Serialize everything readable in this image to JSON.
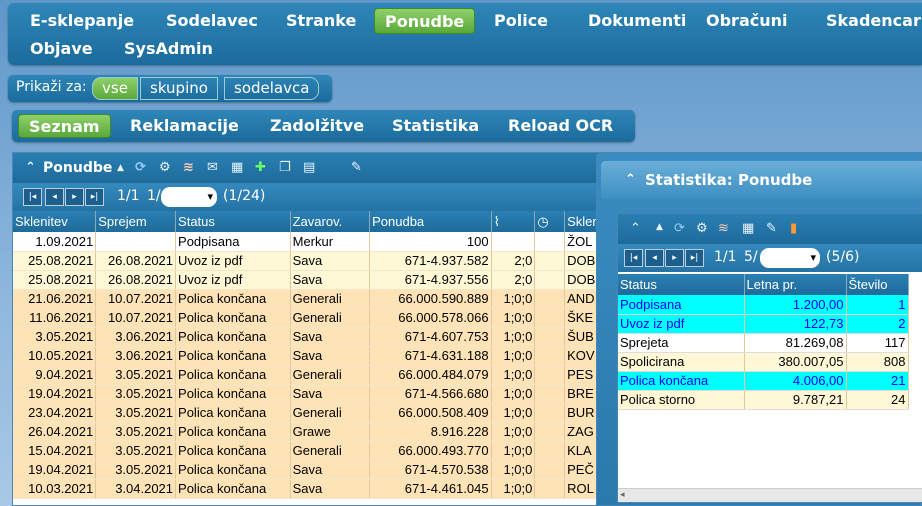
{
  "topnav": {
    "row1": [
      "E-sklepanje",
      "Sodelavec",
      "Stranke",
      "Ponudbe",
      "Police",
      "Dokumenti",
      "Obračuni",
      "Skadencar"
    ],
    "row2": [
      "Objave",
      "SysAdmin"
    ],
    "active": "Ponudbe"
  },
  "filter": {
    "label": "Prikaži za:",
    "options": [
      "vse",
      "skupino",
      "sodelavca"
    ],
    "active": "vse"
  },
  "subnav": {
    "items": [
      "Seznam",
      "Reklamacije",
      "Zadolžitve",
      "Statistika",
      "Reload OCR"
    ],
    "active": "Seznam"
  },
  "main": {
    "title": "Ponudbe",
    "page": "1/1",
    "page2": "1/",
    "count": "(1/24)",
    "columns": [
      "Sklenitev",
      "Sprejem",
      "Status",
      "Zavarov.",
      "Ponudba",
      "",
      "",
      "Sklen"
    ],
    "rows": [
      [
        "1.09.2021",
        "",
        "Podpisana",
        "Merkur",
        "100",
        "",
        "",
        "ŽOL"
      ],
      [
        "25.08.2021",
        "26.08.2021",
        "Uvoz iz pdf",
        "Sava",
        "671-4.937.582",
        "2;0",
        "",
        "DOB"
      ],
      [
        "25.08.2021",
        "26.08.2021",
        "Uvoz iz pdf",
        "Sava",
        "671-4.937.556",
        "2;0",
        "",
        "DOB"
      ],
      [
        "21.06.2021",
        "10.07.2021",
        "Polica končana",
        "Generali",
        "66.000.590.889",
        "1;0;0",
        "",
        "AND"
      ],
      [
        "11.06.2021",
        "10.07.2021",
        "Polica končana",
        "Generali",
        "66.000.578.066",
        "1;0;0",
        "",
        "ŠKE"
      ],
      [
        "3.05.2021",
        "3.06.2021",
        "Polica končana",
        "Sava",
        "671-4.607.753",
        "1;0;0",
        "",
        "ŠUB"
      ],
      [
        "10.05.2021",
        "3.06.2021",
        "Polica končana",
        "Sava",
        "671-4.631.188",
        "1;0;0",
        "",
        "KOV"
      ],
      [
        "9.04.2021",
        "3.05.2021",
        "Polica končana",
        "Generali",
        "66.000.484.079",
        "1;0;0",
        "",
        "PES"
      ],
      [
        "19.04.2021",
        "3.05.2021",
        "Polica končana",
        "Sava",
        "671-4.566.680",
        "1;0;0",
        "",
        "BRE"
      ],
      [
        "23.04.2021",
        "3.05.2021",
        "Polica končana",
        "Generali",
        "66.000.508.409",
        "1;0;0",
        "",
        "BUR"
      ],
      [
        "26.04.2021",
        "3.05.2021",
        "Polica končana",
        "Grawe",
        "8.916.228",
        "1;0;0",
        "",
        "ZAG"
      ],
      [
        "15.04.2021",
        "3.05.2021",
        "Polica končana",
        "Generali",
        "66.000.493.770",
        "1;0;0",
        "",
        "KLA"
      ],
      [
        "19.04.2021",
        "3.05.2021",
        "Polica končana",
        "Sava",
        "671-4.570.538",
        "1;0;0",
        "",
        "PEČ"
      ],
      [
        "10.03.2021",
        "3.04.2021",
        "Polica končana",
        "Sava",
        "671-4.461.045",
        "1;0;0",
        "",
        "ROL"
      ]
    ]
  },
  "stat": {
    "title": "Statistika: Ponudbe",
    "page": "1/1",
    "page2": "5/",
    "count": "(5/6)",
    "columns": [
      "Status",
      "Letna pr.",
      "Število"
    ],
    "rows": [
      [
        "Podpisana",
        "1.200,00",
        "1"
      ],
      [
        "Uvoz iz pdf",
        "122,73",
        "2"
      ],
      [
        "Sprejeta",
        "81.269,08",
        "117"
      ],
      [
        "Spolicirana",
        "380.007,05",
        "808"
      ],
      [
        "Polica končana",
        "4.006,00",
        "21"
      ],
      [
        "Polica storno",
        "9.787,21",
        "24"
      ]
    ]
  }
}
